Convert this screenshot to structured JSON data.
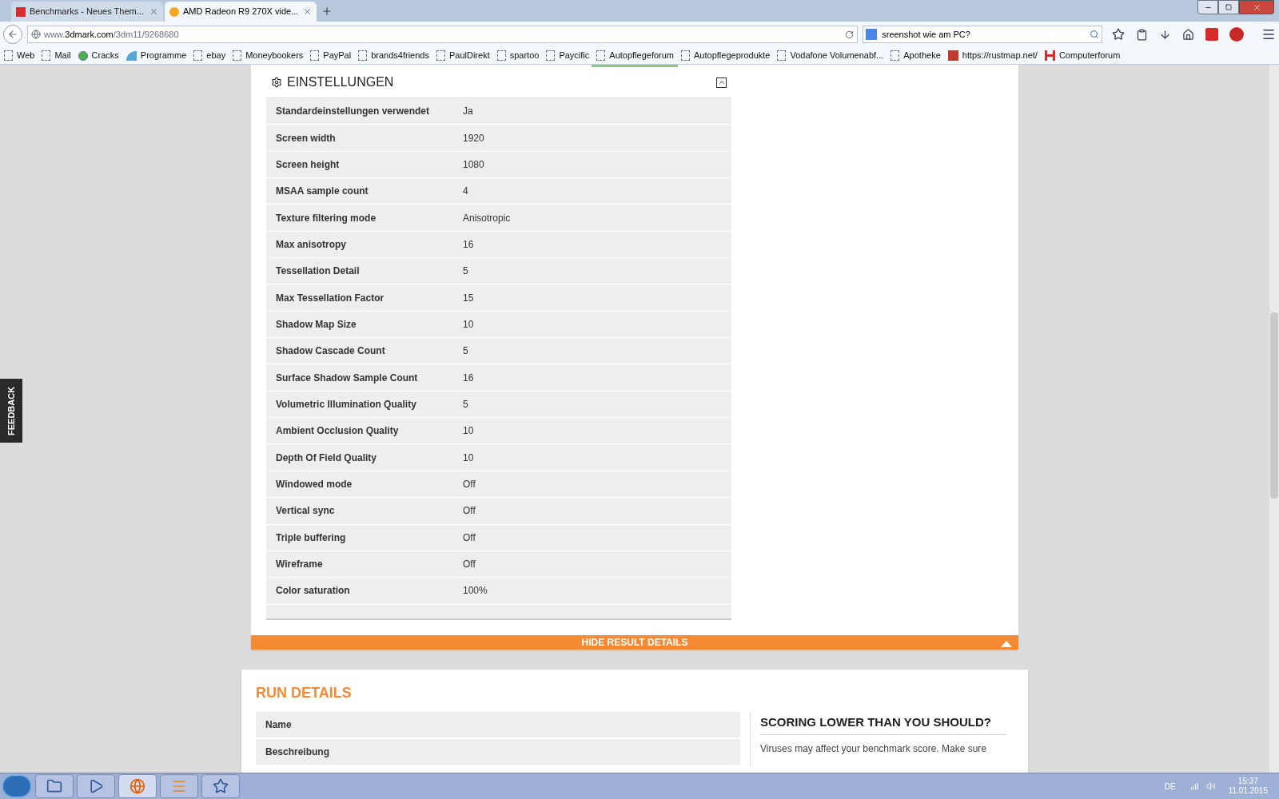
{
  "browser": {
    "tabs": [
      {
        "title": "Benchmarks - Neues Them...",
        "selected": false
      },
      {
        "title": "AMD Radeon R9 270X vide...",
        "selected": true
      }
    ],
    "url_host": "www.",
    "url_domain": "3dmark.com",
    "url_path": "/3dm11/9268680",
    "search_value": "sreenshot wie am PC?",
    "bookmarks": [
      {
        "label": "Web",
        "kind": "blank"
      },
      {
        "label": "Mail",
        "kind": "blank"
      },
      {
        "label": "Cracks",
        "kind": "green"
      },
      {
        "label": "Programme",
        "kind": "blue"
      },
      {
        "label": "ebay",
        "kind": "blank"
      },
      {
        "label": "Moneybookers",
        "kind": "blank"
      },
      {
        "label": "PayPal",
        "kind": "blank"
      },
      {
        "label": "brands4friends",
        "kind": "blank"
      },
      {
        "label": "PaulDirekt",
        "kind": "blank"
      },
      {
        "label": "spartoo",
        "kind": "blank"
      },
      {
        "label": "Paycific",
        "kind": "blank"
      },
      {
        "label": "Autopflegeforum",
        "kind": "blank"
      },
      {
        "label": "Autopflegeprodukte",
        "kind": "blank"
      },
      {
        "label": "Vodafone Volumenabf...",
        "kind": "blank"
      },
      {
        "label": "Apotheke",
        "kind": "blank"
      },
      {
        "label": "https://rustmap.net/",
        "kind": "red"
      },
      {
        "label": "Computerforum",
        "kind": "h"
      }
    ]
  },
  "feedback": "FEEDBACK",
  "settings": {
    "title": "EINSTELLUNGEN",
    "rows": [
      {
        "label": "Standardeinstellungen verwendet",
        "value": "Ja"
      },
      {
        "label": "Screen width",
        "value": "1920"
      },
      {
        "label": "Screen height",
        "value": "1080"
      },
      {
        "label": "MSAA sample count",
        "value": "4"
      },
      {
        "label": "Texture filtering mode",
        "value": "Anisotropic"
      },
      {
        "label": "Max anisotropy",
        "value": "16"
      },
      {
        "label": "Tessellation Detail",
        "value": "5"
      },
      {
        "label": "Max Tessellation Factor",
        "value": "15"
      },
      {
        "label": "Shadow Map Size",
        "value": "10"
      },
      {
        "label": "Shadow Cascade Count",
        "value": "5"
      },
      {
        "label": "Surface Shadow Sample Count",
        "value": "16"
      },
      {
        "label": "Volumetric Illumination Quality",
        "value": "5"
      },
      {
        "label": "Ambient Occlusion Quality",
        "value": "10"
      },
      {
        "label": "Depth Of Field Quality",
        "value": "10"
      },
      {
        "label": "Windowed mode",
        "value": "Off"
      },
      {
        "label": "Vertical sync",
        "value": "Off"
      },
      {
        "label": "Triple buffering",
        "value": "Off"
      },
      {
        "label": "Wireframe",
        "value": "Off"
      },
      {
        "label": "Color saturation",
        "value": "100%"
      }
    ]
  },
  "hide_button": "HIDE RESULT DETAILS",
  "run_details": {
    "title": "RUN DETAILS",
    "rows": [
      "Name",
      "Beschreibung"
    ],
    "side_title": "SCORING LOWER THAN YOU SHOULD?",
    "side_text": "Viruses may affect your benchmark score. Make sure"
  },
  "taskbar": {
    "language": "DE",
    "time": "15:37",
    "date": "11.01.2015"
  }
}
